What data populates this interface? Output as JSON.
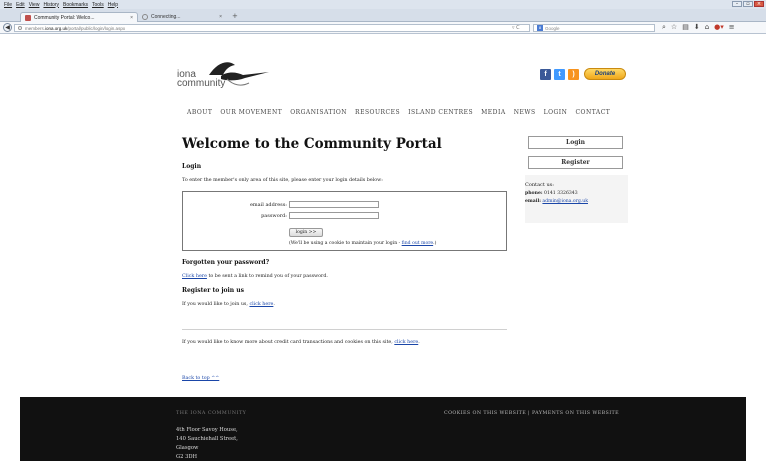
{
  "browser": {
    "menu": [
      "File",
      "Edit",
      "View",
      "History",
      "Bookmarks",
      "Tools",
      "Help"
    ],
    "tabs": [
      {
        "title": "Community Portal: Welco...",
        "close": "×"
      },
      {
        "title": "Connecting...",
        "close": "×"
      }
    ],
    "new_tab": "+",
    "url_prefix": "members.",
    "url_host": "iona.org.uk",
    "url_path": "/portal/public/login/login.aspx",
    "search_placeholder": "Google",
    "window_controls": [
      "–",
      "▫",
      "×"
    ]
  },
  "site": {
    "logo_line1": "iona",
    "logo_line2": "community",
    "social": {
      "facebook": "f",
      "twitter": "t",
      "rss": ")"
    },
    "donate_label": "Donate",
    "nav": [
      "ABOUT",
      "OUR MOVEMENT",
      "ORGANISATION",
      "RESOURCES",
      "ISLAND CENTRES",
      "MEDIA",
      "NEWS",
      "LOGIN",
      "CONTACT"
    ]
  },
  "main": {
    "title": "Welcome to the Community Portal",
    "login_heading": "Login",
    "intro": "To enter the member's only area of this site, please enter your login details below:",
    "email_label": "email address:",
    "email_value": "",
    "password_label": "password:",
    "password_value": "",
    "login_button": "login >>",
    "cookie_note_pre": "(We'll be using a cookie to maintain your login - ",
    "cookie_note_link": "find out more",
    "cookie_note_post": ".)",
    "forgot_heading": "Forgotten your password?",
    "forgot_link": "Click here",
    "forgot_text": " to be sent a link to remind you of your password.",
    "register_heading": "Register to join us",
    "register_text": "If you would like to join us, ",
    "register_link": "click here",
    "register_post": ".",
    "credit_text": "If you would like to know more about credit card transactions and cookies on this site, ",
    "credit_link": "click here",
    "credit_post": ".",
    "back_to_top": "Back to top ^^"
  },
  "sidebar": {
    "login_button": "Login",
    "register_button": "Register",
    "contact_title": "Contact us:",
    "phone_label": "phone:",
    "phone_value": " 0141 3326343",
    "email_label": "email:",
    "email_value": "admin@iona.org.uk"
  },
  "footer": {
    "title": "THE IONA COMMUNITY",
    "links": "COOKIES ON THIS WEBSITE | PAYMENTS ON THIS WEBSITE",
    "address": [
      "4th Floor Savoy House,",
      "140 Sauchiehall Street,",
      "Glasgow",
      "G2 3DH"
    ]
  }
}
